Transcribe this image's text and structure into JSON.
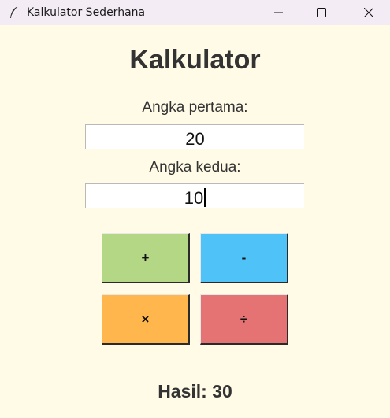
{
  "window": {
    "title": "Kalkulator Sederhana",
    "icon": "feather-icon",
    "controls": [
      "minimize-icon",
      "maximize-icon",
      "close-icon"
    ]
  },
  "app": {
    "heading": "Kalkulator",
    "first_label": "Angka pertama:",
    "first_value": "20",
    "second_label": "Angka kedua:",
    "second_value": "10",
    "buttons": {
      "add": "+",
      "subtract": "-",
      "multiply": "×",
      "divide": "÷"
    },
    "result": "Hasil: 30"
  },
  "colors": {
    "background": "#fffbe7",
    "add": "#b3d785",
    "subtract": "#4fc3f7",
    "multiply": "#ffb74d",
    "divide": "#e57373"
  }
}
